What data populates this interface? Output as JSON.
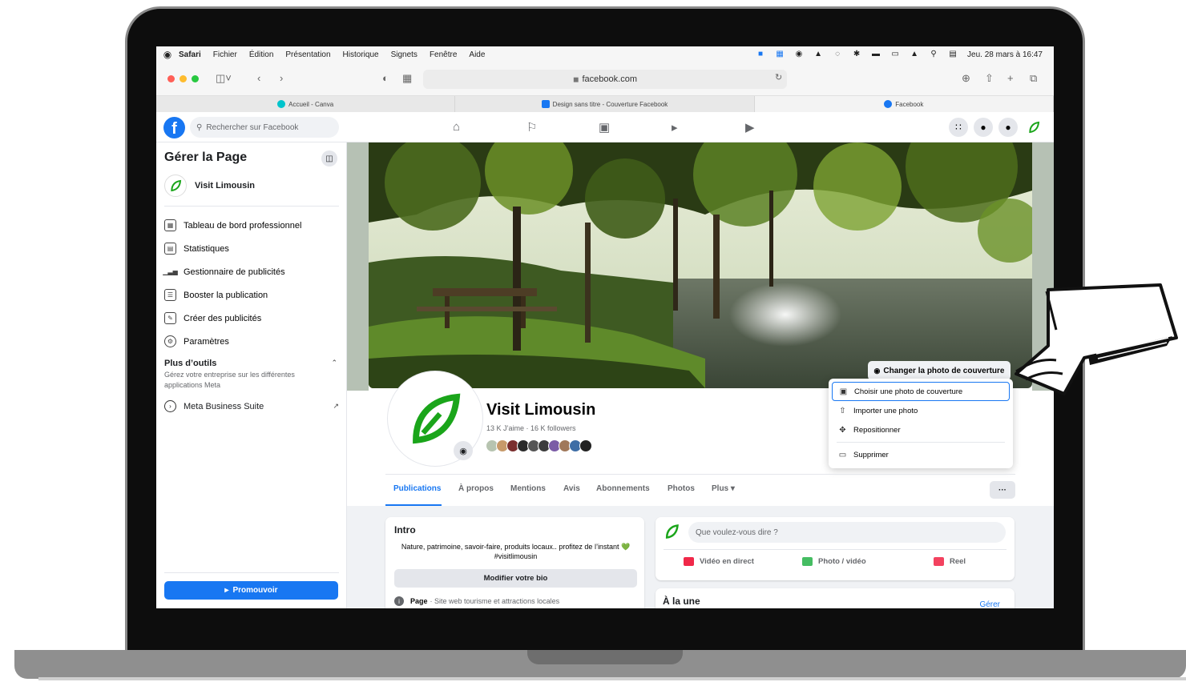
{
  "menubar": {
    "app": "Safari",
    "items": [
      "Fichier",
      "Édition",
      "Présentation",
      "Historique",
      "Signets",
      "Fenêtre",
      "Aide"
    ],
    "datetime": "Jeu. 28 mars à 16:47"
  },
  "browser": {
    "url": "facebook.com",
    "tabs": [
      {
        "label": "Accueil - Canva",
        "color": "#00c4cc"
      },
      {
        "label": "Design sans titre - Couverture Facebook",
        "color": "#1877f2"
      },
      {
        "label": "Facebook",
        "color": "#1877f2"
      }
    ]
  },
  "facebook": {
    "logo": "f",
    "search_placeholder": "Rechercher sur Facebook",
    "nav_icons": [
      "home-icon",
      "flag-icon",
      "marketplace-icon",
      "megaphone-icon",
      "video-icon"
    ],
    "right_icons": [
      "menu-grid-icon",
      "messenger-icon",
      "bell-icon",
      "profile-leaf-icon"
    ]
  },
  "sidebar": {
    "title": "Gérer la Page",
    "page_name": "Visit Limousin",
    "items": [
      {
        "label": "Tableau de bord professionnel",
        "icon": "dashboard-icon"
      },
      {
        "label": "Statistiques",
        "icon": "insights-icon"
      },
      {
        "label": "Gestionnaire de publicités",
        "icon": "ads-manager-icon"
      },
      {
        "label": "Booster la publication",
        "icon": "boost-icon"
      },
      {
        "label": "Créer des publicités",
        "icon": "edit-icon"
      },
      {
        "label": "Paramètres",
        "icon": "settings-icon"
      }
    ],
    "tools_title": "Plus d’outils",
    "tools_subtitle": "Gérez votre entreprise sur les différentes applications Meta",
    "meta_suite": "Meta Business Suite",
    "promote": "Promouvoir"
  },
  "page": {
    "name": "Visit Limousin",
    "stats": "13 K J’aime · 16 K followers",
    "change_cover": "Changer la photo de couverture",
    "cover_menu": [
      {
        "label": "Choisir une photo de couverture",
        "icon": "choose-photo-icon"
      },
      {
        "label": "Importer une photo",
        "icon": "upload-icon"
      },
      {
        "label": "Repositionner",
        "icon": "move-icon"
      },
      {
        "label": "Supprimer",
        "icon": "trash-icon"
      }
    ],
    "tabs": [
      "Publications",
      "À propos",
      "Mentions",
      "Avis",
      "Abonnements",
      "Photos",
      "Plus ▾"
    ],
    "more": "···"
  },
  "intro": {
    "title": "Intro",
    "bio": "Nature, patrimoine, savoir-faire, produits locaux.. profitez de l’instant 💚 #visitlimousin",
    "edit_bio": "Modifier votre bio",
    "page_label": "Page",
    "page_category": "· Site web tourisme et attractions locales"
  },
  "composer": {
    "placeholder": "Que voulez-vous dire ?",
    "live": "Vidéo en direct",
    "photo": "Photo / vidéo",
    "reel": "Reel"
  },
  "featured": {
    "title": "À la une",
    "manage": "Gérer"
  },
  "colors": {
    "brand": "#1877f2",
    "leaf": "#1aa51a"
  }
}
